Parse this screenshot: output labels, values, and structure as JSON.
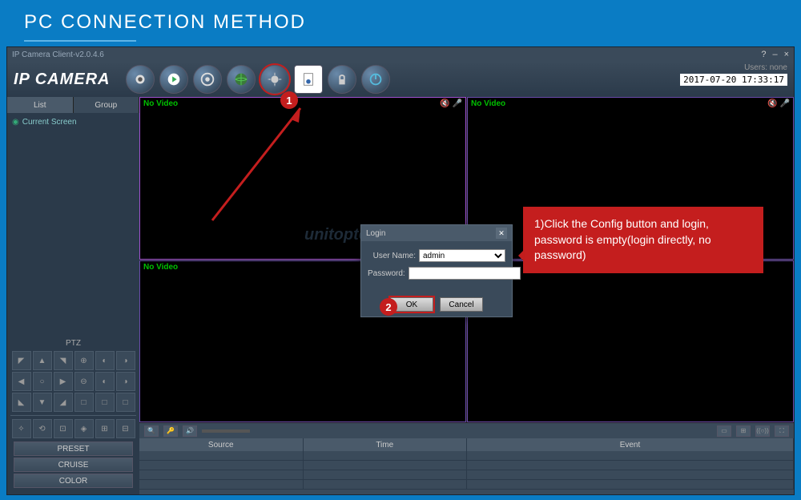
{
  "banner": {
    "title": "PC CONNECTION METHOD"
  },
  "window": {
    "title": "IP Camera Client-v2.0.4.6",
    "logo": "IP CAMERA",
    "users_label": "Users: none",
    "timestamp": "2017-07-20 17:33:17"
  },
  "sidebar": {
    "tabs": {
      "list": "List",
      "group": "Group"
    },
    "tree_item": "Current Screen",
    "ptz_title": "PTZ",
    "footer_buttons": {
      "preset": "PRESET",
      "cruise": "CRUISE",
      "color": "COLOR"
    }
  },
  "video": {
    "no_video": "No Video"
  },
  "events": {
    "cols": {
      "source": "Source",
      "time": "Time",
      "event": "Event"
    }
  },
  "login": {
    "title": "Login",
    "username_label": "User Name:",
    "username_value": "admin",
    "password_label": "Password:",
    "ok": "OK",
    "cancel": "Cancel"
  },
  "callout": {
    "text": "1)Click the Config button and login, password is empty(login directly, no password)"
  },
  "markers": {
    "one": "1",
    "two": "2"
  },
  "watermark": "unitoptek"
}
